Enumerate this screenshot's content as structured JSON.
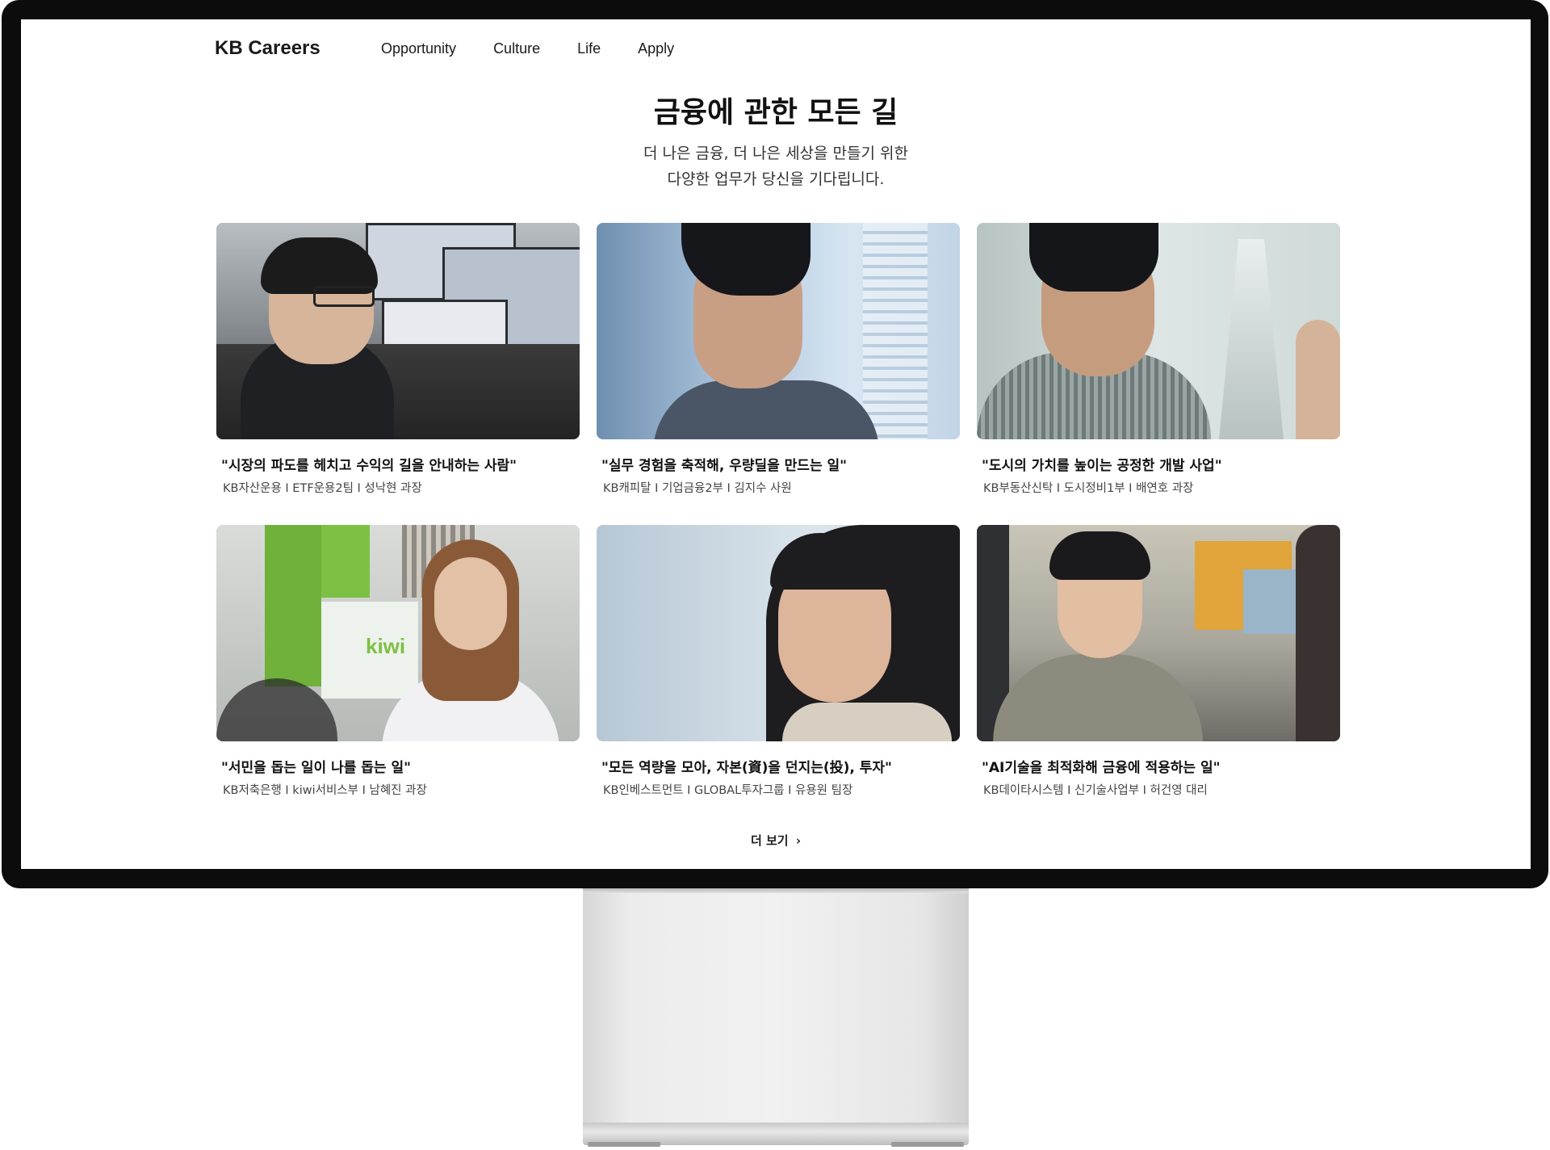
{
  "header": {
    "logo": "KB Careers",
    "nav": [
      "Opportunity",
      "Culture",
      "Life",
      "Apply"
    ]
  },
  "hero": {
    "title": "금융에 관한 모든 길",
    "subtitle_line1": "더 나은 금융, 더 나은 세상을 만들기 위한",
    "subtitle_line2": "다양한 업무가 당신을 기다립니다."
  },
  "cards": [
    {
      "quote": "\"시장의 파도를 헤치고 수익의 길을 안내하는 사람\"",
      "meta": "KB자산운용 I ETF운용2팀 I 성낙현 과장"
    },
    {
      "quote": "\"실무 경험을 축적해, 우량딜을 만드는 일\"",
      "meta": "KB캐피탈 I 기업금융2부 I 김지수 사원"
    },
    {
      "quote": "\"도시의 가치를 높이는 공정한 개발 사업\"",
      "meta": "KB부동산신탁 I 도시정비1부 I 배연호 과장"
    },
    {
      "quote": "\"서민을 돕는 일이 나를 돕는 일\"",
      "meta": "KB저축은행 I kiwi서비스부 I 남혜진 과장"
    },
    {
      "quote": "\"모든 역량을 모아, 자본(資)을 던지는(投), 투자\"",
      "meta": "KB인베스트먼트 I GLOBAL투자그룹 I 유용원 팀장"
    },
    {
      "quote": "\"AI기술을 최적화해 금융에 적용하는 일\"",
      "meta": "KB데이타시스템 I 신기술사업부 I 허건영 대리"
    }
  ],
  "photo_text": {
    "kiwi_sign": "kiwi"
  },
  "more": {
    "label": "더 보기",
    "chevron": "›"
  },
  "colors": {
    "bezel": "#0c0c0c",
    "screen": "#ffffff",
    "text": "#111111"
  },
  "icons": {
    "chevron": "chevron-right-icon"
  }
}
